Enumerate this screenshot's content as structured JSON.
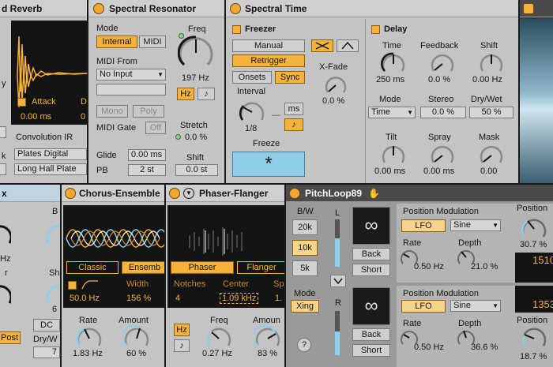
{
  "reverb": {
    "title": "d Reverb",
    "attack_label": "Attack",
    "decay_letter": "D",
    "attack_value": "0.00 ms",
    "decay_value": "0",
    "conv_label": "Convolution IR",
    "ir_category": "Plates Digital",
    "ir_file": "Long Hall Plate",
    "left_letter_y": "y",
    "left_letter_k": "k"
  },
  "spectral_resonator": {
    "title": "Spectral Resonator",
    "mode_label": "Mode",
    "mode_internal": "Internal",
    "mode_midi": "MIDI",
    "midi_from_label": "MIDI From",
    "midi_from_value": "No Input",
    "mono": "Mono",
    "poly": "Poly",
    "midi_gate_label": "MIDI Gate",
    "midi_gate_value": "Off",
    "glide_label": "Glide",
    "glide_value": "0.00 ms",
    "pb_label": "PB",
    "pb_value": "2 st",
    "freq_label": "Freq",
    "freq_value": "197 Hz",
    "hz_btn": "Hz",
    "note_btn": "♪",
    "stretch_label": "Stretch",
    "stretch_value": "0.0 %",
    "shift_label": "Shift",
    "shift_value": "0.0 st"
  },
  "spectral_time": {
    "title": "Spectral Time",
    "freezer_label": "Freezer",
    "manual": "Manual",
    "retrigger": "Retrigger",
    "onsets": "Onsets",
    "sync": "Sync",
    "xfade_label": "X-Fade",
    "xfade_value": "0.0 %",
    "interval_label": "Interval",
    "interval_value": "1/8",
    "ms_btn": "ms",
    "note_btn": "♪",
    "freeze_label": "Freeze",
    "freeze_symbol": "*",
    "delay_label": "Delay",
    "time_label": "Time",
    "time_value": "250 ms",
    "feedback_label": "Feedback",
    "feedback_value": "0.0 %",
    "shift_label": "Shift",
    "shift_value": "0.00 Hz",
    "mode_label": "Mode",
    "mode_value": "Time",
    "stereo_label": "Stereo",
    "stereo_value": "0.0 %",
    "drywet_label": "Dry/Wet",
    "drywet_value": "50 %",
    "tilt_label": "Tilt",
    "tilt_value": "0.00 ms",
    "spray_label": "Spray",
    "spray_value": "0.00 ms",
    "mask_label": "Mask",
    "mask_value": "0.00"
  },
  "left_bottom": {
    "title": "x",
    "letter_b": "B",
    "hz_partial": "Hz",
    "letter_r": "r",
    "sh_partial": "Sh",
    "num_6": "6",
    "dc_btn": "DC",
    "post_btn": "Post",
    "drywet_partial": "Dry/W",
    "value_7": "7"
  },
  "chorus": {
    "title": "Chorus-Ensemble",
    "classic": "Classic",
    "ensemble": "Ensemb",
    "rate_small": "50.0 Hz",
    "width_label": "Width",
    "width_value": "156 %",
    "rate_label": "Rate",
    "rate_value": "1.83 Hz",
    "amount_label": "Amount",
    "amount_value": "60 %"
  },
  "phaser": {
    "title": "Phaser-Flanger",
    "phaser_btn": "Phaser",
    "flanger_btn": "Flanger",
    "notches_label": "Notches",
    "notches_value": "4",
    "center_label": "Center",
    "center_value": "1.09 kHz",
    "sp_partial": "Sp",
    "sp_value": "1.",
    "hz_btn": "Hz",
    "note_btn": "♪",
    "freq_label": "Freq",
    "freq_value": "0.27 Hz",
    "amount_label": "Amoun",
    "amount_value": "83 %"
  },
  "pitchloop": {
    "title": "PitchLoop89",
    "bw_label": "B/W",
    "bw_20k": "20k",
    "bw_10k": "10k",
    "bw_5k": "5k",
    "l_label": "L",
    "r_label": "R",
    "mode_label": "Mode",
    "mode_value": "Xing",
    "help": "?",
    "loop_symbol": "∞",
    "back_1": "Back",
    "short_1": "Short",
    "back_2": "Back",
    "short_2": "Short",
    "posmod_label_1": "Position Modulation",
    "lfo_1": "LFO",
    "sine_1": "Sine",
    "rate_label_1": "Rate",
    "rate_value_1": "0.50 Hz",
    "depth_label_1": "Depth",
    "depth_value_1": "21.0 %",
    "position_label_1": "Position",
    "position_value_1": "30.7 %",
    "display_1": "1510",
    "posmod_label_2": "Position Modulation",
    "lfo_2": "LFO",
    "sine_2": "Sine",
    "rate_label_2": "Rate",
    "rate_value_2": "0.50 Hz",
    "depth_label_2": "Depth",
    "depth_value_2": "36.6 %",
    "position_label_2": "Position",
    "position_value_2": "18.7 %",
    "display_2": "1353"
  }
}
